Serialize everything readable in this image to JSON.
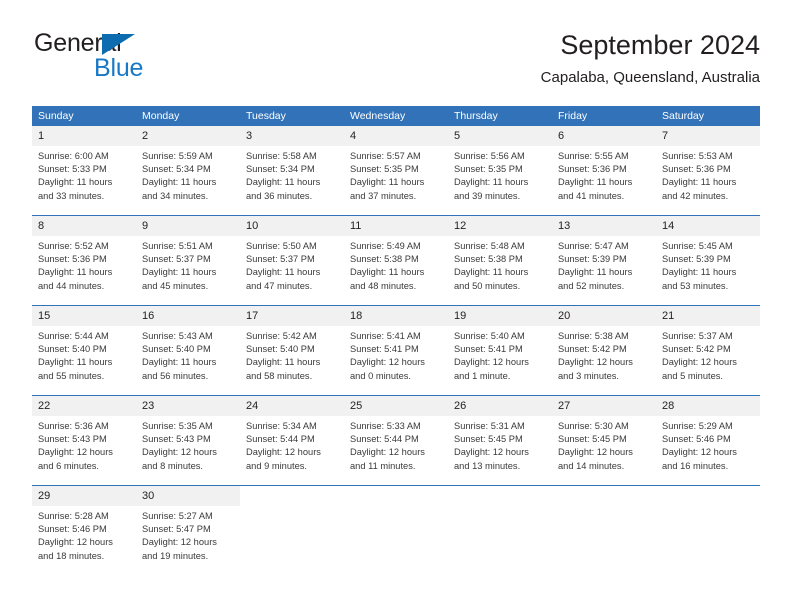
{
  "brand": {
    "name_part1": "General",
    "name_part2": "Blue",
    "triangle_color": "#0d6cb0",
    "blue_text_color": "#1878c4"
  },
  "header": {
    "title": "September 2024",
    "subtitle": "Capalaba, Queensland, Australia"
  },
  "theme": {
    "header_bg": "#3272b8",
    "header_text": "#ffffff",
    "daynum_bg": "#f1f1f1",
    "row_divider": "#3272b8"
  },
  "calendar": {
    "weekday_headers": [
      "Sunday",
      "Monday",
      "Tuesday",
      "Wednesday",
      "Thursday",
      "Friday",
      "Saturday"
    ],
    "weeks": [
      [
        {
          "day": "1",
          "sunrise": "Sunrise: 6:00 AM",
          "sunset": "Sunset: 5:33 PM",
          "daylight_line1": "Daylight: 11 hours",
          "daylight_line2": "and 33 minutes."
        },
        {
          "day": "2",
          "sunrise": "Sunrise: 5:59 AM",
          "sunset": "Sunset: 5:34 PM",
          "daylight_line1": "Daylight: 11 hours",
          "daylight_line2": "and 34 minutes."
        },
        {
          "day": "3",
          "sunrise": "Sunrise: 5:58 AM",
          "sunset": "Sunset: 5:34 PM",
          "daylight_line1": "Daylight: 11 hours",
          "daylight_line2": "and 36 minutes."
        },
        {
          "day": "4",
          "sunrise": "Sunrise: 5:57 AM",
          "sunset": "Sunset: 5:35 PM",
          "daylight_line1": "Daylight: 11 hours",
          "daylight_line2": "and 37 minutes."
        },
        {
          "day": "5",
          "sunrise": "Sunrise: 5:56 AM",
          "sunset": "Sunset: 5:35 PM",
          "daylight_line1": "Daylight: 11 hours",
          "daylight_line2": "and 39 minutes."
        },
        {
          "day": "6",
          "sunrise": "Sunrise: 5:55 AM",
          "sunset": "Sunset: 5:36 PM",
          "daylight_line1": "Daylight: 11 hours",
          "daylight_line2": "and 41 minutes."
        },
        {
          "day": "7",
          "sunrise": "Sunrise: 5:53 AM",
          "sunset": "Sunset: 5:36 PM",
          "daylight_line1": "Daylight: 11 hours",
          "daylight_line2": "and 42 minutes."
        }
      ],
      [
        {
          "day": "8",
          "sunrise": "Sunrise: 5:52 AM",
          "sunset": "Sunset: 5:36 PM",
          "daylight_line1": "Daylight: 11 hours",
          "daylight_line2": "and 44 minutes."
        },
        {
          "day": "9",
          "sunrise": "Sunrise: 5:51 AM",
          "sunset": "Sunset: 5:37 PM",
          "daylight_line1": "Daylight: 11 hours",
          "daylight_line2": "and 45 minutes."
        },
        {
          "day": "10",
          "sunrise": "Sunrise: 5:50 AM",
          "sunset": "Sunset: 5:37 PM",
          "daylight_line1": "Daylight: 11 hours",
          "daylight_line2": "and 47 minutes."
        },
        {
          "day": "11",
          "sunrise": "Sunrise: 5:49 AM",
          "sunset": "Sunset: 5:38 PM",
          "daylight_line1": "Daylight: 11 hours",
          "daylight_line2": "and 48 minutes."
        },
        {
          "day": "12",
          "sunrise": "Sunrise: 5:48 AM",
          "sunset": "Sunset: 5:38 PM",
          "daylight_line1": "Daylight: 11 hours",
          "daylight_line2": "and 50 minutes."
        },
        {
          "day": "13",
          "sunrise": "Sunrise: 5:47 AM",
          "sunset": "Sunset: 5:39 PM",
          "daylight_line1": "Daylight: 11 hours",
          "daylight_line2": "and 52 minutes."
        },
        {
          "day": "14",
          "sunrise": "Sunrise: 5:45 AM",
          "sunset": "Sunset: 5:39 PM",
          "daylight_line1": "Daylight: 11 hours",
          "daylight_line2": "and 53 minutes."
        }
      ],
      [
        {
          "day": "15",
          "sunrise": "Sunrise: 5:44 AM",
          "sunset": "Sunset: 5:40 PM",
          "daylight_line1": "Daylight: 11 hours",
          "daylight_line2": "and 55 minutes."
        },
        {
          "day": "16",
          "sunrise": "Sunrise: 5:43 AM",
          "sunset": "Sunset: 5:40 PM",
          "daylight_line1": "Daylight: 11 hours",
          "daylight_line2": "and 56 minutes."
        },
        {
          "day": "17",
          "sunrise": "Sunrise: 5:42 AM",
          "sunset": "Sunset: 5:40 PM",
          "daylight_line1": "Daylight: 11 hours",
          "daylight_line2": "and 58 minutes."
        },
        {
          "day": "18",
          "sunrise": "Sunrise: 5:41 AM",
          "sunset": "Sunset: 5:41 PM",
          "daylight_line1": "Daylight: 12 hours",
          "daylight_line2": "and 0 minutes."
        },
        {
          "day": "19",
          "sunrise": "Sunrise: 5:40 AM",
          "sunset": "Sunset: 5:41 PM",
          "daylight_line1": "Daylight: 12 hours",
          "daylight_line2": "and 1 minute."
        },
        {
          "day": "20",
          "sunrise": "Sunrise: 5:38 AM",
          "sunset": "Sunset: 5:42 PM",
          "daylight_line1": "Daylight: 12 hours",
          "daylight_line2": "and 3 minutes."
        },
        {
          "day": "21",
          "sunrise": "Sunrise: 5:37 AM",
          "sunset": "Sunset: 5:42 PM",
          "daylight_line1": "Daylight: 12 hours",
          "daylight_line2": "and 5 minutes."
        }
      ],
      [
        {
          "day": "22",
          "sunrise": "Sunrise: 5:36 AM",
          "sunset": "Sunset: 5:43 PM",
          "daylight_line1": "Daylight: 12 hours",
          "daylight_line2": "and 6 minutes."
        },
        {
          "day": "23",
          "sunrise": "Sunrise: 5:35 AM",
          "sunset": "Sunset: 5:43 PM",
          "daylight_line1": "Daylight: 12 hours",
          "daylight_line2": "and 8 minutes."
        },
        {
          "day": "24",
          "sunrise": "Sunrise: 5:34 AM",
          "sunset": "Sunset: 5:44 PM",
          "daylight_line1": "Daylight: 12 hours",
          "daylight_line2": "and 9 minutes."
        },
        {
          "day": "25",
          "sunrise": "Sunrise: 5:33 AM",
          "sunset": "Sunset: 5:44 PM",
          "daylight_line1": "Daylight: 12 hours",
          "daylight_line2": "and 11 minutes."
        },
        {
          "day": "26",
          "sunrise": "Sunrise: 5:31 AM",
          "sunset": "Sunset: 5:45 PM",
          "daylight_line1": "Daylight: 12 hours",
          "daylight_line2": "and 13 minutes."
        },
        {
          "day": "27",
          "sunrise": "Sunrise: 5:30 AM",
          "sunset": "Sunset: 5:45 PM",
          "daylight_line1": "Daylight: 12 hours",
          "daylight_line2": "and 14 minutes."
        },
        {
          "day": "28",
          "sunrise": "Sunrise: 5:29 AM",
          "sunset": "Sunset: 5:46 PM",
          "daylight_line1": "Daylight: 12 hours",
          "daylight_line2": "and 16 minutes."
        }
      ],
      [
        {
          "day": "29",
          "sunrise": "Sunrise: 5:28 AM",
          "sunset": "Sunset: 5:46 PM",
          "daylight_line1": "Daylight: 12 hours",
          "daylight_line2": "and 18 minutes."
        },
        {
          "day": "30",
          "sunrise": "Sunrise: 5:27 AM",
          "sunset": "Sunset: 5:47 PM",
          "daylight_line1": "Daylight: 12 hours",
          "daylight_line2": "and 19 minutes."
        },
        {
          "day": "",
          "sunrise": "",
          "sunset": "",
          "daylight_line1": "",
          "daylight_line2": ""
        },
        {
          "day": "",
          "sunrise": "",
          "sunset": "",
          "daylight_line1": "",
          "daylight_line2": ""
        },
        {
          "day": "",
          "sunrise": "",
          "sunset": "",
          "daylight_line1": "",
          "daylight_line2": ""
        },
        {
          "day": "",
          "sunrise": "",
          "sunset": "",
          "daylight_line1": "",
          "daylight_line2": ""
        },
        {
          "day": "",
          "sunrise": "",
          "sunset": "",
          "daylight_line1": "",
          "daylight_line2": ""
        }
      ]
    ]
  }
}
